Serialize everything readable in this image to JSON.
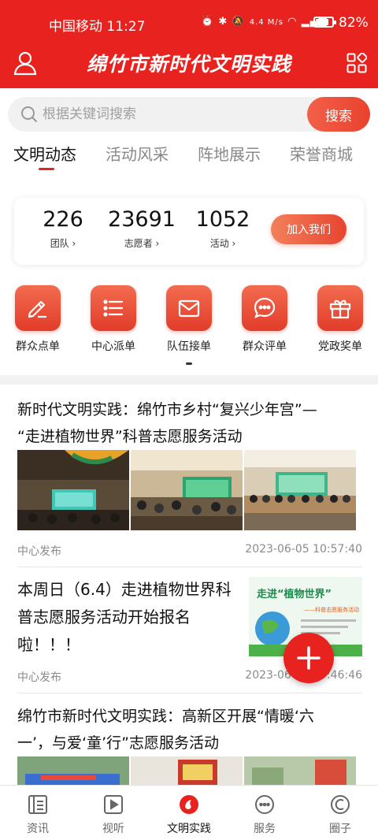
{
  "status_bar": {
    "carrier_time": "中国移动 11:27",
    "network_speed": "4.4 M/s",
    "battery": "82%",
    "battery_level": 0.82
  },
  "header": {
    "title": "绵竹市新时代文明实践",
    "background_color": "#e8231f"
  },
  "search": {
    "placeholder": "根据关键词搜索",
    "button_label": "搜索"
  },
  "tabs": [
    {
      "label": "文明动态",
      "active": true
    },
    {
      "label": "活动风采",
      "active": false
    },
    {
      "label": "阵地展示",
      "active": false
    },
    {
      "label": "荣誉商城",
      "active": false
    }
  ],
  "stats": {
    "items": [
      {
        "value": "226",
        "label": "团队 ›"
      },
      {
        "value": "23691",
        "label": "志愿者 ›"
      },
      {
        "value": "1052",
        "label": "活动 ›"
      }
    ],
    "join_label": "加入我们"
  },
  "quick_actions": [
    {
      "label": "群众点单",
      "icon": "pencil-icon"
    },
    {
      "label": "中心派单",
      "icon": "list-icon"
    },
    {
      "label": "队伍接单",
      "icon": "envelope-icon"
    },
    {
      "label": "群众评单",
      "icon": "chat-bubble-icon"
    },
    {
      "label": "党政奖单",
      "icon": "gift-icon"
    }
  ],
  "news": [
    {
      "title_line1": "新时代文明实践：绵竹市乡村“复兴少年宫”—",
      "title_line2": "“走进植物世界”科普志愿服务活动",
      "source": "中心发布",
      "time": "2023-06-05 10:57:40"
    },
    {
      "title_line1": "本周日（6.4）走进植物世界科",
      "title_line2": "普志愿服务活动开始报名",
      "title_line3": "啦！！！",
      "source": "中心发布",
      "time": "2023-06-05 09:46:46",
      "poster_heading": "走进“植物世界”",
      "poster_subheading": "——科普志愿服务活动"
    },
    {
      "title_line1": "绵竹市新时代文明实践：高新区开展“情暖‘六",
      "title_line2": "一’，与爱‘童’行”志愿服务活动"
    }
  ],
  "bottom_nav": [
    {
      "label": "资讯",
      "icon": "news-icon",
      "active": false
    },
    {
      "label": "视听",
      "icon": "play-icon",
      "active": false
    },
    {
      "label": "文明实践",
      "icon": "civilization-logo-icon",
      "active": true
    },
    {
      "label": "服务",
      "icon": "service-chat-icon",
      "active": false
    },
    {
      "label": "圈子",
      "icon": "circle-icon",
      "active": false
    }
  ]
}
